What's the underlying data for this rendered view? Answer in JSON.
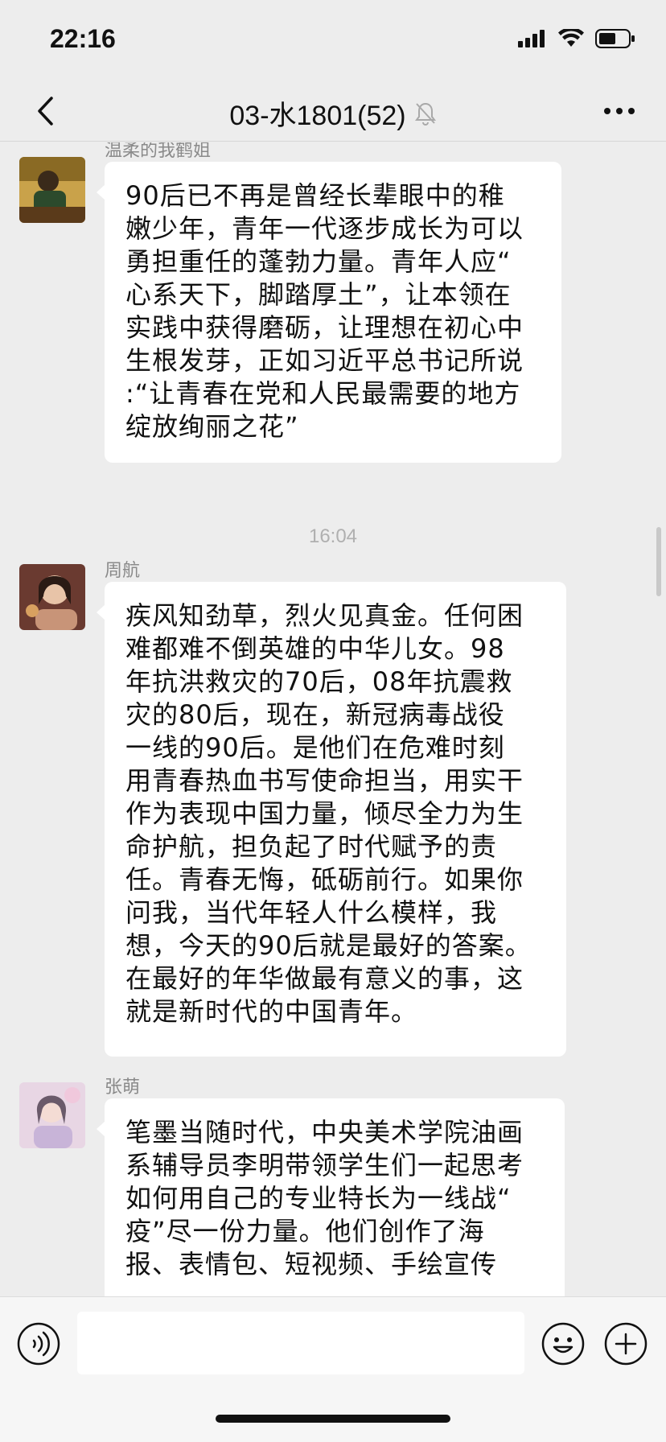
{
  "status_bar": {
    "time": "22:16"
  },
  "nav": {
    "title": "03-水1801(52)"
  },
  "messages": [
    {
      "sender": "温柔的我鹤姐",
      "text": "90后已不再是曾经长辈眼中的稚\n嫩少年，青年一代逐步成长为可以\n勇担重任的蓬勃力量。青年人应“\n心系天下，脚踏厚土”，让本领在\n实践中获得磨砺，让理想在初心中\n生根发芽，正如习近平总书记所说\n:“让青春在党和人民最需要的地方\n绽放绚丽之花”"
    },
    {
      "sender": "周航",
      "text": "疾风知劲草，烈火见真金。任何困\n难都难不倒英雄的中华儿女。98\n年抗洪救灾的70后，08年抗震救\n灾的80后，现在，新冠病毒战役\n一线的90后。是他们在危难时刻\n用青春热血书写使命担当，用实干\n作为表现中国力量，倾尽全力为生\n命护航，担负起了时代赋予的责\n任。青春无悔，砥砺前行。如果你\n问我，当代年轻人什么模样，我\n想，今天的90后就是最好的答案。\n在最好的年华做最有意义的事，这\n就是新时代的中国青年。"
    },
    {
      "sender": "张萌",
      "text": "笔墨当随时代，中央美术学院油画\n系辅导员李明带领学生们一起思考\n如何用自己的专业特长为一线战“\n疫”尽一份力量。他们创作了海\n报、表情包、短视频、手绘宣传"
    }
  ],
  "time_separator": "16:04",
  "colors": {
    "background": "#ededed",
    "bubble": "#ffffff",
    "meta_text": "#8a8a8a"
  },
  "icons": {
    "back": "chevron-left-icon",
    "mute": "bell-muted-icon",
    "more": "more-dots-icon",
    "voice": "voice-icon",
    "emoji": "emoji-icon",
    "plus": "plus-icon"
  }
}
